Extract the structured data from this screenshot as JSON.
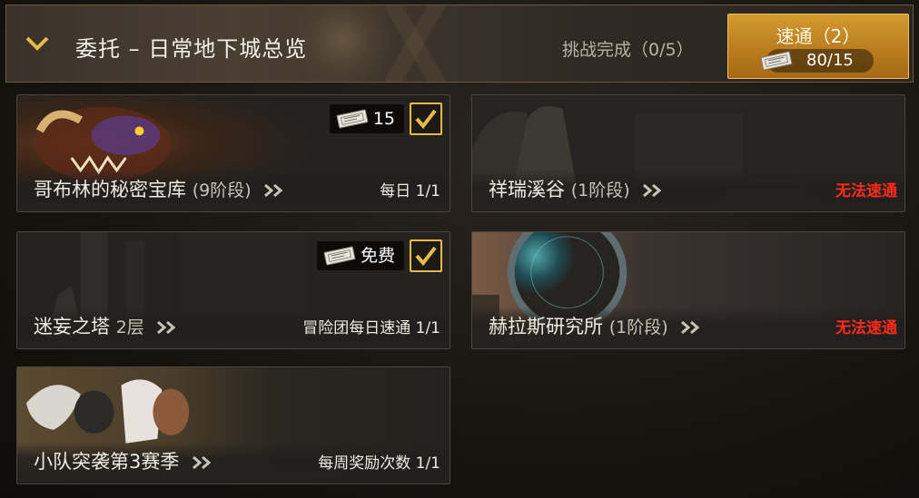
{
  "header": {
    "title": "委托 – 日常地下城总览",
    "challenge_status": "挑战完成（0/5）",
    "speed_button": {
      "label": "速通（2）",
      "count": "80/15"
    }
  },
  "dungeons": [
    {
      "name": "哥布林的秘密宝库",
      "sub": "(9阶段)",
      "status": "每日 1/1",
      "status_color": "#f0ebe0",
      "cost": "15",
      "checked": true
    },
    {
      "name": "祥瑞溪谷",
      "sub": "(1阶段)",
      "status": "无法速通",
      "status_color": "#ff2a1a",
      "cost": null,
      "checked": false
    },
    {
      "name": "迷妄之塔",
      "sub": "2层",
      "status": "冒险团每日速通 1/1",
      "status_color": "#f0ebe0",
      "cost": "免费",
      "checked": true
    },
    {
      "name": "赫拉斯研究所",
      "sub": "(1阶段)",
      "status": "无法速通",
      "status_color": "#ff2a1a",
      "cost": null,
      "checked": false
    },
    {
      "name": "小队突袭第3赛季",
      "sub": "",
      "status": "每周奖励次数 1/1",
      "status_color": "#f0ebe0",
      "cost": null,
      "checked": false
    }
  ],
  "colors": {
    "accent_gold": "#e5b94a",
    "speed_button": "#c58a26",
    "unavailable": "#ff2a1a"
  },
  "icons": [
    "chevron-down-icon",
    "ticket-icon",
    "checkmark-icon",
    "double-chevron-right-icon"
  ]
}
